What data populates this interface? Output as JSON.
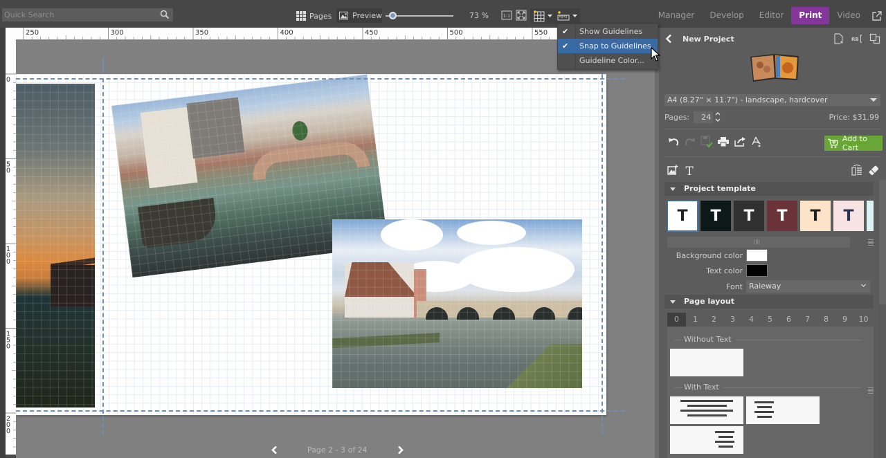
{
  "toolbar": {
    "search_placeholder": "Quick Search",
    "pages_label": "Pages",
    "preview_label": "Preview",
    "zoom_value": "73 %",
    "zoom_fraction": 0.05,
    "actual_size_label": "1:1"
  },
  "module_tabs": [
    {
      "label": "Manager",
      "active": false
    },
    {
      "label": "Develop",
      "active": false
    },
    {
      "label": "Editor",
      "active": false
    },
    {
      "label": "Print",
      "active": true
    },
    {
      "label": "Video",
      "active": false
    }
  ],
  "accent_color": "#84369a",
  "ruler": {
    "top_ticks": [
      "250",
      "300",
      "350",
      "400",
      "450",
      "500",
      "550"
    ],
    "left_ticks": [
      "0",
      "50",
      "100",
      "150",
      "200"
    ]
  },
  "guideline_menu": {
    "items": [
      {
        "label": "Show Guidelines",
        "checked": true,
        "highlighted": false
      },
      {
        "label": "Snap to Guidelines",
        "checked": true,
        "highlighted": true
      },
      {
        "label": "Guideline Color...",
        "checked": false,
        "highlighted": false
      }
    ]
  },
  "canvas": {
    "photos": [
      "sunset-barn",
      "venice-canal-bridge",
      "regensburg-stone-bridge"
    ],
    "guideline_color": "#6f8fb4"
  },
  "pager": {
    "label": "Page 2 - 3 of 24"
  },
  "panel": {
    "project_title": "New Project",
    "format": "A4 (8.27\" × 11.7\") - landscape, hardcover",
    "pages_label": "Pages:",
    "pages_value": "24",
    "price": "Price: $31.99",
    "add_to_cart_label": "Add to Cart",
    "add_to_cart_color": "#6aa537",
    "project_template": {
      "header": "Project template",
      "templates": [
        {
          "bg": "#ffffff",
          "fg": "#222222",
          "selected": true
        },
        {
          "bg": "#0d1818",
          "fg": "#ffffff",
          "selected": false
        },
        {
          "bg": "#303030",
          "fg": "#ffffff",
          "selected": false
        },
        {
          "bg": "#6a3338",
          "fg": "#ffffff",
          "selected": false
        },
        {
          "bg": "#fde3c8",
          "fg": "#222222",
          "selected": false
        },
        {
          "bg": "#f7e3e3",
          "fg": "#2b3355",
          "selected": false
        },
        {
          "bg": "#d9f4f2",
          "fg": "#222222",
          "selected": false
        }
      ],
      "background_color_label": "Background color",
      "background_color": "#ffffff",
      "text_color_label": "Text color",
      "text_color": "#000000",
      "font_label": "Font",
      "font_value": "Raleway"
    },
    "page_layout": {
      "header": "Page layout",
      "tabs": [
        "0",
        "1",
        "2",
        "3",
        "4",
        "5",
        "6",
        "7",
        "8",
        "9",
        "10"
      ],
      "active_tab": "0",
      "without_text_label": "Without Text",
      "with_text_label": "With Text"
    }
  }
}
